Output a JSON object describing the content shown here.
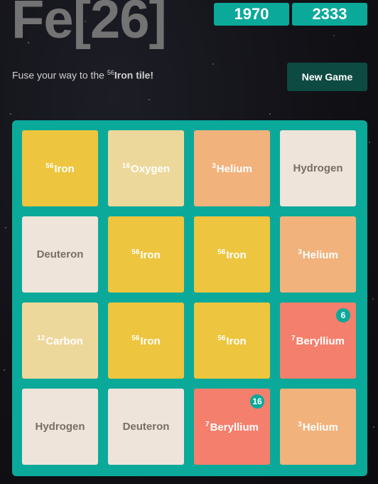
{
  "header": {
    "title": "Fe[26]",
    "scores": [
      "1970",
      "2333"
    ],
    "subtitle_before": "Fuse your way to the ",
    "subtitle_sup": "56",
    "subtitle_strong": "Iron tile!",
    "new_game_label": "New Game"
  },
  "board": {
    "rows": [
      [
        {
          "sup": "56",
          "name": "Iron",
          "bg": "#edc53f",
          "color": "#ffffff"
        },
        {
          "sup": "16",
          "name": "Oxygen",
          "bg": "#edd89b",
          "color": "#ffffff"
        },
        {
          "sup": "3",
          "name": "Helium",
          "bg": "#f2b27c",
          "color": "#ffffff"
        },
        {
          "sup": "",
          "name": "Hydrogen",
          "bg": "#eee4da",
          "color": "#776e65"
        }
      ],
      [
        {
          "sup": "",
          "name": "Deuteron",
          "bg": "#eee4da",
          "color": "#776e65"
        },
        {
          "sup": "56",
          "name": "Iron",
          "bg": "#edc53f",
          "color": "#ffffff"
        },
        {
          "sup": "56",
          "name": "Iron",
          "bg": "#edc53f",
          "color": "#ffffff"
        },
        {
          "sup": "3",
          "name": "Helium",
          "bg": "#f2b27c",
          "color": "#ffffff"
        }
      ],
      [
        {
          "sup": "12",
          "name": "Carbon",
          "bg": "#edd89b",
          "color": "#ffffff"
        },
        {
          "sup": "56",
          "name": "Iron",
          "bg": "#edc53f",
          "color": "#ffffff"
        },
        {
          "sup": "56",
          "name": "Iron",
          "bg": "#edc53f",
          "color": "#ffffff"
        },
        {
          "sup": "7",
          "name": "Beryllium",
          "bg": "#f47f6c",
          "color": "#ffffff",
          "badge": "6"
        }
      ],
      [
        {
          "sup": "",
          "name": "Hydrogen",
          "bg": "#eee4da",
          "color": "#776e65"
        },
        {
          "sup": "",
          "name": "Deuteron",
          "bg": "#eee4da",
          "color": "#776e65"
        },
        {
          "sup": "7",
          "name": "Beryllium",
          "bg": "#f47f6c",
          "color": "#ffffff",
          "badge": "16"
        },
        {
          "sup": "3",
          "name": "Helium",
          "bg": "#f2b27c",
          "color": "#ffffff"
        }
      ]
    ]
  }
}
